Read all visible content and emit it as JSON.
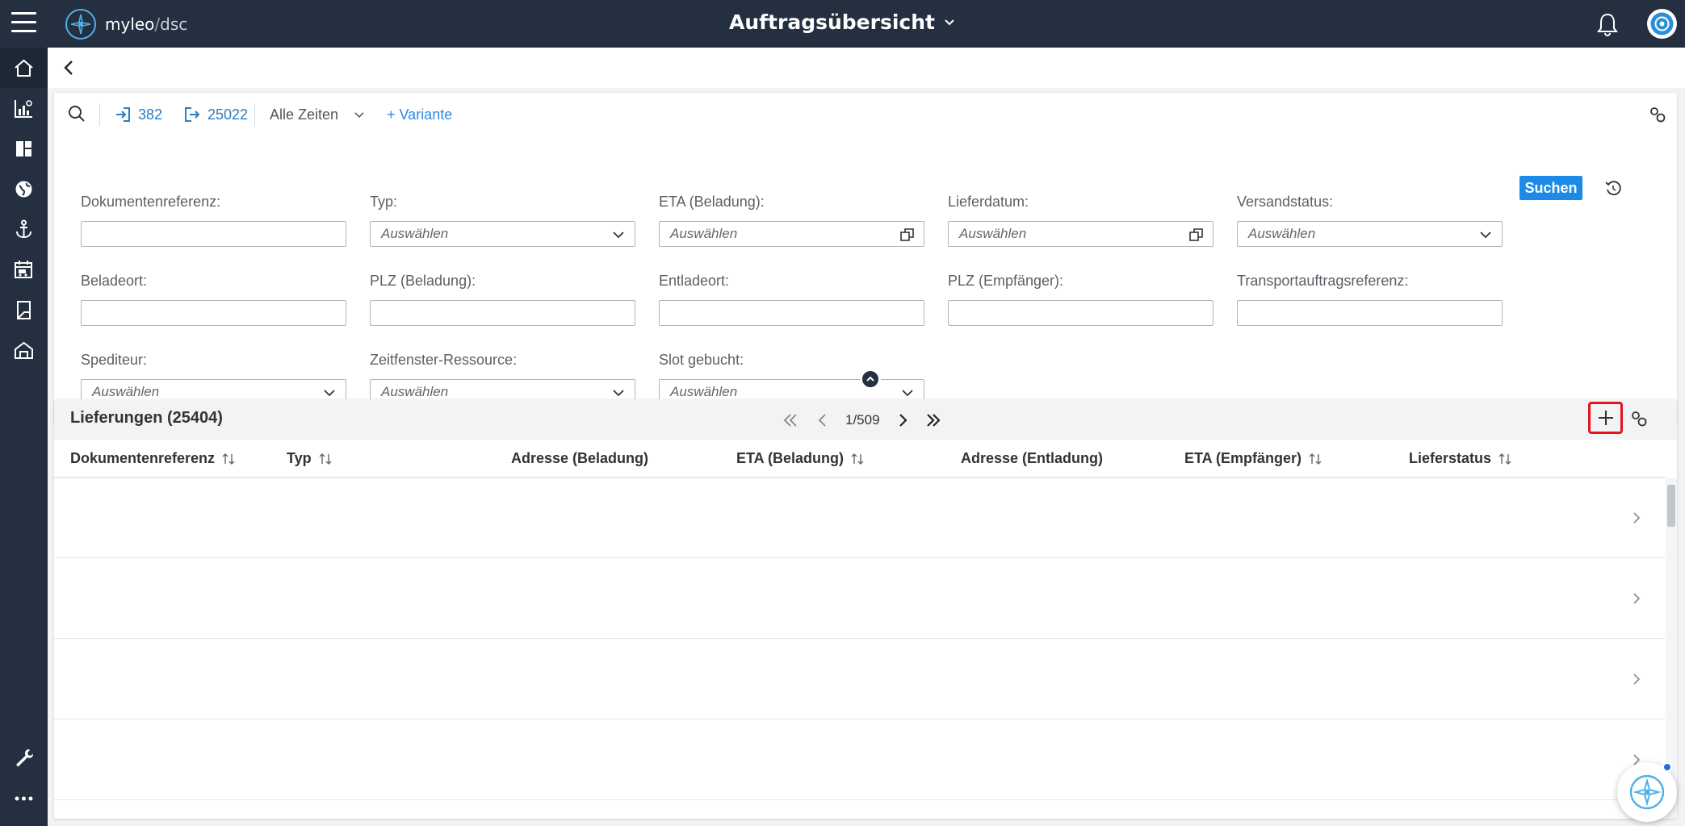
{
  "app": {
    "logo_name": "myleo",
    "logo_sep": "/",
    "logo_sub": "dsc",
    "page_title": "Auftragsübersicht"
  },
  "sidebar": {
    "items": [
      {
        "icon": "home-icon"
      },
      {
        "icon": "chart-icon"
      },
      {
        "icon": "dashboard-icon"
      },
      {
        "icon": "globe-icon"
      },
      {
        "icon": "anchor-icon"
      },
      {
        "icon": "truck-calendar-icon"
      },
      {
        "icon": "document-icon"
      },
      {
        "icon": "warehouse-icon"
      },
      {
        "icon": "wrench-icon"
      },
      {
        "icon": "more-icon"
      }
    ]
  },
  "toolbar": {
    "import_count": "382",
    "export_count": "25022",
    "time_range": "Alle Zeiten",
    "add_variant": "+ Variante"
  },
  "filters": {
    "dokumentenreferenz": {
      "label": "Dokumentenreferenz:",
      "value": ""
    },
    "typ": {
      "label": "Typ:",
      "placeholder": "Auswählen"
    },
    "eta_beladung": {
      "label": "ETA (Beladung):",
      "placeholder": "Auswählen"
    },
    "lieferdatum": {
      "label": "Lieferdatum:",
      "placeholder": "Auswählen"
    },
    "versandstatus": {
      "label": "Versandstatus:",
      "placeholder": "Auswählen"
    },
    "beladeort": {
      "label": "Beladeort:",
      "value": ""
    },
    "plz_beladung": {
      "label": "PLZ (Beladung):",
      "value": ""
    },
    "entladeort": {
      "label": "Entladeort:",
      "value": ""
    },
    "plz_empfaenger": {
      "label": "PLZ (Empfänger):",
      "value": ""
    },
    "transportauftragsreferenz": {
      "label": "Transportauftragsreferenz:",
      "value": ""
    },
    "spediteur": {
      "label": "Spediteur:",
      "placeholder": "Auswählen"
    },
    "zeitfenster_ressource": {
      "label": "Zeitfenster-Ressource:",
      "placeholder": "Auswählen"
    },
    "slot_gebucht": {
      "label": "Slot gebucht:",
      "placeholder": "Auswählen"
    },
    "search_button": "Suchen"
  },
  "list": {
    "title": "Lieferungen (25404)",
    "page": "1/509",
    "columns": [
      {
        "label": "Dokumentenreferenz",
        "sortable": true
      },
      {
        "label": "Typ",
        "sortable": true
      },
      {
        "label": "Adresse (Beladung)",
        "sortable": false
      },
      {
        "label": "ETA (Beladung)",
        "sortable": true
      },
      {
        "label": "Adresse (Entladung)",
        "sortable": false
      },
      {
        "label": "ETA (Empfänger)",
        "sortable": true
      },
      {
        "label": "Lieferstatus",
        "sortable": true
      }
    ],
    "row_count_visible": 4
  },
  "colors": {
    "topbar": "#243040",
    "accent": "#1e8ae8",
    "highlight": "#e8121a"
  }
}
